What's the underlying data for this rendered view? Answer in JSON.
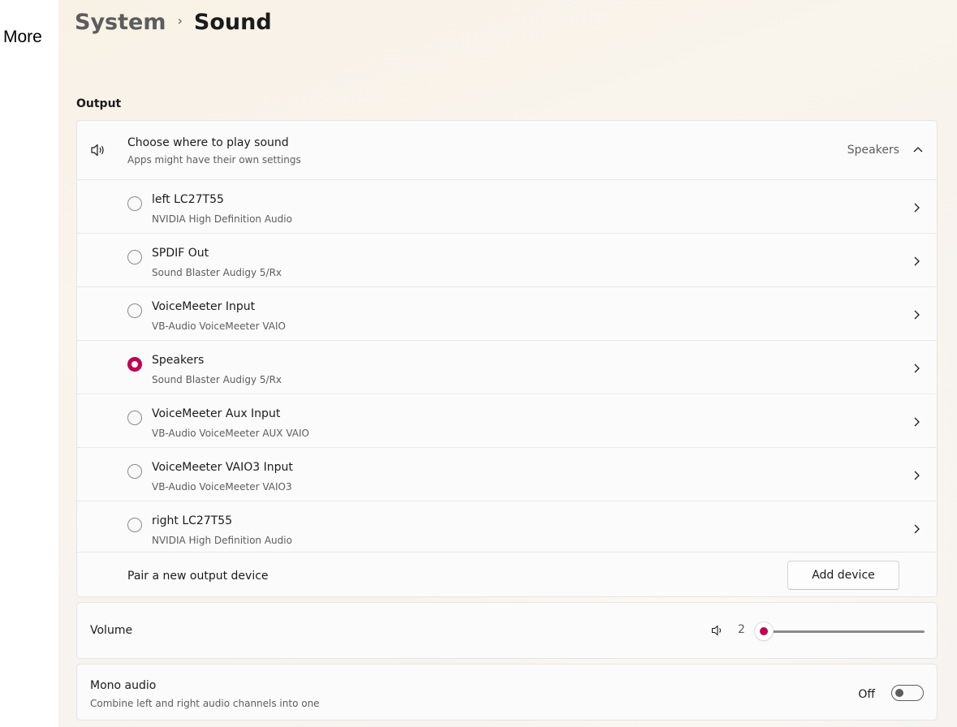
{
  "sidebar": {
    "more_label": "More"
  },
  "header": {
    "parent": "System",
    "separator": "›",
    "current": "Sound"
  },
  "output": {
    "section_title": "Output",
    "choose": {
      "title": "Choose where to play sound",
      "subtitle": "Apps might have their own settings",
      "selected": "Speakers",
      "icon": "speaker-icon",
      "expand_icon": "chevron-up-icon"
    },
    "devices": [
      {
        "name": "left LC27T55",
        "driver": "NVIDIA High Definition Audio",
        "selected": false
      },
      {
        "name": "SPDIF Out",
        "driver": "Sound Blaster Audigy 5/Rx",
        "selected": false
      },
      {
        "name": "VoiceMeeter Input",
        "driver": "VB-Audio VoiceMeeter VAIO",
        "selected": false
      },
      {
        "name": "Speakers",
        "driver": "Sound Blaster Audigy 5/Rx",
        "selected": true
      },
      {
        "name": "VoiceMeeter Aux Input",
        "driver": "VB-Audio VoiceMeeter AUX VAIO",
        "selected": false
      },
      {
        "name": "VoiceMeeter VAIO3 Input",
        "driver": "VB-Audio VoiceMeeter VAIO3",
        "selected": false
      },
      {
        "name": "right LC27T55",
        "driver": "NVIDIA High Definition Audio",
        "selected": false
      }
    ],
    "pair": {
      "label": "Pair a new output device",
      "button_label": "Add device"
    }
  },
  "volume": {
    "label": "Volume",
    "value": "2",
    "level_percent": 2,
    "icon": "speaker-low-icon"
  },
  "mono_audio": {
    "title": "Mono audio",
    "subtitle": "Combine left and right audio channels into one",
    "state": "Off"
  },
  "colors": {
    "accent": "#c30052",
    "text": "#1b1b1b",
    "secondary_text": "#5d5d5d"
  }
}
